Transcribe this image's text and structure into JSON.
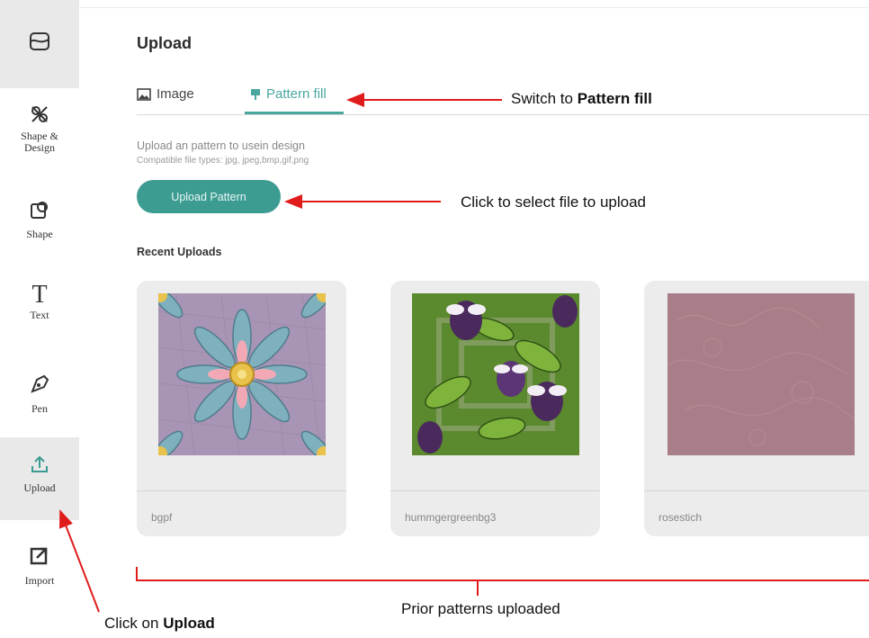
{
  "sidebar": {
    "items": [
      {
        "label": ""
      },
      {
        "label_line1": "Shape &",
        "label_line2": "Design"
      },
      {
        "label": "Shape"
      },
      {
        "label": "Text"
      },
      {
        "label": "Pen"
      },
      {
        "label": "Upload"
      },
      {
        "label": "Import"
      }
    ]
  },
  "panel": {
    "title": "Upload",
    "tabs": [
      {
        "label": "Image",
        "icon": "image-icon"
      },
      {
        "label": "Pattern fill",
        "icon": "pattern-icon",
        "active": true
      }
    ],
    "hint_line1": "Upload an pattern to usein design",
    "hint_line2": "Compatible file types: jpg, jpeg,bmp,gif,png",
    "upload_button": "Upload Pattern",
    "recent_title": "Recent Uploads",
    "uploads": [
      {
        "name": "bgpf"
      },
      {
        "name": "hummgergreenbg3"
      },
      {
        "name": "rosestich"
      }
    ]
  },
  "annotations": {
    "switch_prefix": "Switch to ",
    "switch_bold": "Pattern fill",
    "click_select": "Click to select file to upload",
    "prior": "Prior patterns uploaded",
    "click_on_prefix": "Click on ",
    "click_on_bold": "Upload"
  },
  "colors": {
    "accent": "#3c9c92",
    "arrow": "#e01b1b",
    "sidebar_active": "#e9e9e9"
  }
}
